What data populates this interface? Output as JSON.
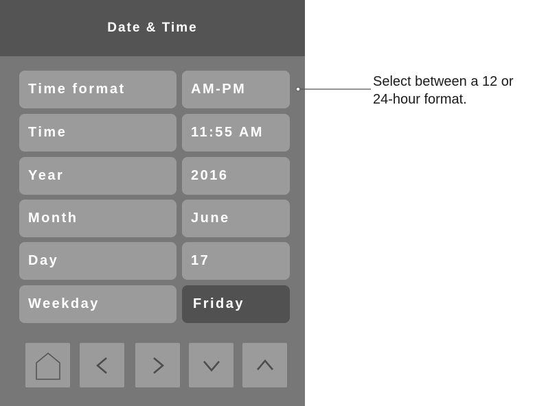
{
  "header": {
    "title": "Date & Time"
  },
  "rows": [
    {
      "label": "Time format",
      "value": "AM-PM"
    },
    {
      "label": "Time",
      "value": "11:55 AM"
    },
    {
      "label": "Year",
      "value": "2016"
    },
    {
      "label": "Month",
      "value": "June"
    },
    {
      "label": "Day",
      "value": "17"
    },
    {
      "label": "Weekday",
      "value": "Friday"
    }
  ],
  "selected_row": "Weekday",
  "nav_buttons": [
    {
      "icon": "home-icon"
    },
    {
      "icon": "chevron-left-icon"
    },
    {
      "icon": "chevron-right-icon"
    },
    {
      "icon": "chevron-down-icon"
    },
    {
      "icon": "chevron-up-icon"
    }
  ],
  "callout": {
    "line1": "Select between a 12 or",
    "line2": "24-hour format."
  },
  "colors": {
    "panel": "#777777",
    "header": "#545454",
    "button": "#9b9b9b",
    "selected_button": "#515151",
    "text": "#ffffff"
  }
}
